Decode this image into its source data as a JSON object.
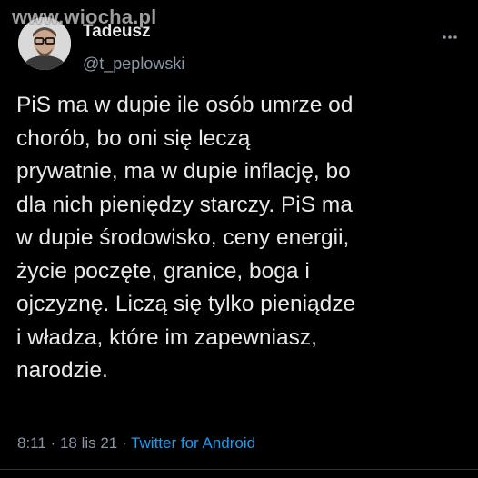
{
  "watermark": "www.wiocha.pl",
  "author": {
    "name": "Tadeusz",
    "handle": "@t_peplowski"
  },
  "tweet": {
    "text": "PiS ma w dupie ile osób umrze od\nchorób, bo oni się leczą\nprywatnie, ma w dupie inflację, bo\ndla nich pieniędzy starczy. PiS ma\nw dupie środowisko, ceny energii,\nżycie poczęte, granice, boga i\nojczyznę. Liczą się tylko pieniądze\ni władza, które im zapewniasz,\nnarodzie."
  },
  "meta": {
    "time": "8:11",
    "separator": " · ",
    "date": "18 lis 21",
    "source": "Twitter for Android"
  },
  "icons": {
    "more": "more-options-icon"
  },
  "colors": {
    "background": "#000000",
    "text": "#e7e9ea",
    "secondary": "#8b98a5",
    "link": "#1d9bf0"
  }
}
